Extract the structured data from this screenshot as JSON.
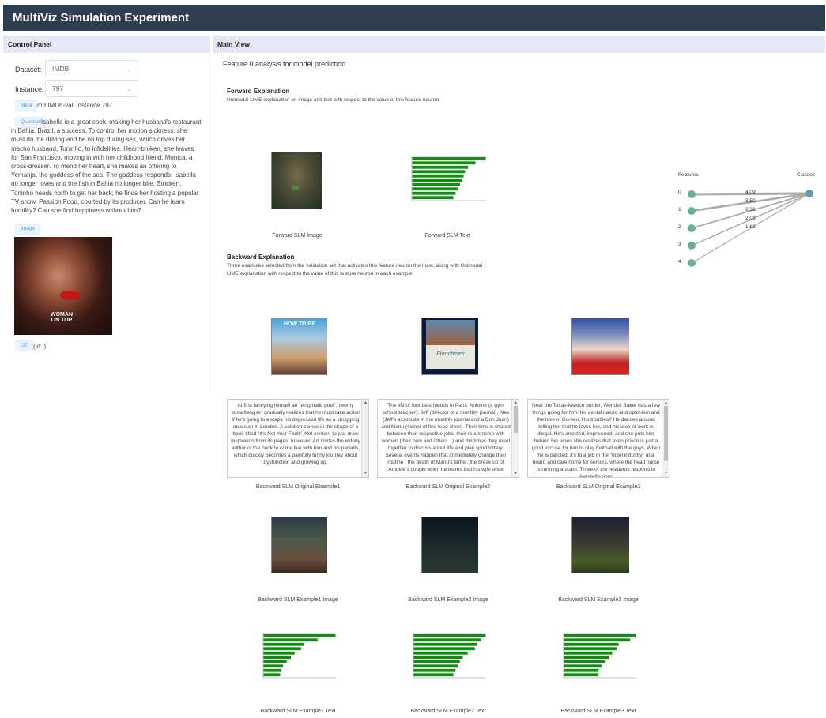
{
  "app": {
    "title": "MultiViz Simulation Experiment"
  },
  "control_panel": {
    "header": "Control Panel",
    "dataset_label": "Dataset:",
    "dataset_value": "IMDB",
    "instance_label": "Instance:",
    "instance_value": "797",
    "meta_tag": "Meta",
    "meta_text": "mmIMDb-val: instance 797",
    "question_tag": "Question",
    "question_text": "Isabella is a great cook, making her husband's restaurant in Bahia, Brazil, a success. To control her motion sickness, she must do the driving and be on top during sex, which drives her macho husband, Toninho, to infidelities. Heart-broken, she leaves for San Francisco, moving in with her childhood friend, Monica, a cross-dresser. To mend her heart, she makes an offering to Yemanja, the goddess of the sea. The goddess responds: Isabella no longer loves and the fish in Bahia no longer bite. Stricken, Toninho heads north to get her back; he finds her hosting a popular TV show, Passion Food, courted by its producer. Can he learn humility? Can she find happiness without him?",
    "image_tag": "Image",
    "poster_text": "WOMAN ON TOP",
    "gt_tag": "GT",
    "gt_text": "(id: )"
  },
  "main_view": {
    "header": "Main View",
    "analysis_title": "Feature 0 analysis for model prediction",
    "forward": {
      "title": "Forward Explanation",
      "desc": "Unimodal LIME explanation on image and text with respect to the value of this feature neuron",
      "image_caption": "Forward SLM Image",
      "text_caption": "Forward SLM Text"
    },
    "backward": {
      "title": "Backward Explanation",
      "desc1": "Three examples selected from the validation set that activates this feature neuron the most, along with Unimodal",
      "desc2": "LIME explanation with respect to the value of this feature neuron in each example",
      "examples": [
        {
          "poster_title": "HOW TO BE",
          "text": "At first fancying himself an \"enigmatic poet\", twenty something Art gradually realizes that he must take action if he's going to escape his depressed life as a struggling musician in London. A solution comes in the shape of a book titled \"It's Not Your Fault\". Not content to just draw inspiration from its pages, however, Art invites the elderly author of the book to come live with him and his parents, which quickly becomes a painfully funny journey about dysfunction and growing up.",
          "original_caption": "Backward SLM Original Example1",
          "image_caption": "Backward SLM Example1 Image",
          "text_caption": "Backward SLM Example1 Text"
        },
        {
          "poster_title": "Frenchmen",
          "text": "The life of four best friends in Paris: Antoine (a gym school teacher), Jeff (director of a monthly journal), Alex (Jeff's associate in the monthly journal and a Don Juan) and Manu (owner of fine food store). Their time is shared between their respective jobs, their relationship with women (their own and others...) and the times they meet together to discuss about life and play sport lottery. Several events happen that immediately change their routine : the death of Manu's father, the break up of Antoine's couple when he learns that his wife once",
          "original_caption": "Backward SLM Original Example2",
          "image_caption": "Backward SLM Example2 Image",
          "text_caption": "Backward SLM Example2 Text"
        },
        {
          "poster_title": "",
          "text": "Near the Texas-Mexico border, Wendell Baker has a few things going for him: his genial nature and optimism and the love of Doreen. His troubles? He dances around telling her that he loves her, and his idea of work is illegal. He's arrested, imprisoned, and she puts him behind her when she realizes that even prison is just a good excuse for him to play football with the guys. When he is paroled, it's to a job in the \"hotel industry\" at a board and care home for seniors, where the head nurse is running a scam. Three of the residents respond to Wendell's good",
          "original_caption": "Backward SLM Original Example3",
          "image_caption": "Backward SLM Example3 Image",
          "text_caption": "Backward SLM Example3 Text"
        }
      ]
    },
    "graph": {
      "features_label": "Features",
      "classes_label": "Classes",
      "nodes": [
        "0",
        "1",
        "2",
        "3",
        "4"
      ],
      "weights": [
        "4.09",
        "3.50",
        "2.32",
        "2.03",
        "1.62"
      ]
    }
  },
  "chart_data": [
    {
      "type": "bar",
      "name": "Forward SLM Text",
      "values": [
        10,
        8.6,
        7.6,
        7.2,
        7.0,
        6.8,
        6.5,
        6.2,
        5.9,
        5.6
      ]
    },
    {
      "type": "bar",
      "name": "Backward SLM Example1 Text",
      "values": [
        10,
        7.5,
        5.6,
        5.2,
        4.3,
        3.8,
        3.2,
        2.7,
        2.5,
        2.3
      ]
    },
    {
      "type": "bar",
      "name": "Backward SLM Example2 Text",
      "values": [
        10,
        9.4,
        8.8,
        8.5,
        7.5,
        6.8,
        6.4,
        6.1,
        5.8,
        5.5
      ]
    },
    {
      "type": "bar",
      "name": "Backward SLM Example3 Text",
      "values": [
        10,
        9.2,
        7.6,
        7.3,
        6.7,
        6.3,
        5.7,
        5.2,
        4.8,
        4.8
      ]
    }
  ],
  "colors": {
    "header_bg": "#2c3e50",
    "panel_header_bg": "#e4e8f4",
    "bar": "#128c12",
    "node": "#6ab0a0",
    "tag_text": "#409eff"
  }
}
